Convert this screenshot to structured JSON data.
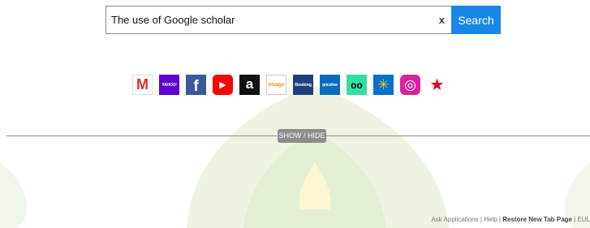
{
  "search": {
    "query": "The use of Google scholar",
    "clear_label": "x",
    "button_label": "Search"
  },
  "shortcuts": [
    {
      "name": "gmail",
      "label": "M",
      "color": "#ffffff"
    },
    {
      "name": "yahoo",
      "label": "YAHOO!",
      "color": "#5f01d1"
    },
    {
      "name": "facebook",
      "label": "f",
      "color": "#3b5998"
    },
    {
      "name": "youtube",
      "label": "▶",
      "color": "#ff0000"
    },
    {
      "name": "amazon",
      "label": "a",
      "color": "#111111"
    },
    {
      "name": "trivago",
      "label": "trivago",
      "color": "#ffffff"
    },
    {
      "name": "booking",
      "label": "Booking",
      "color": "#1e3f7a"
    },
    {
      "name": "priceline",
      "label": "priceline",
      "color": "#0a6bbd"
    },
    {
      "name": "tripadvisor",
      "label": "oo",
      "color": "#34e0a1"
    },
    {
      "name": "walmart",
      "label": "✳",
      "color": "#0071ce"
    },
    {
      "name": "instagram",
      "label": "◎",
      "color": "#d6249f"
    },
    {
      "name": "macys",
      "label": "★",
      "color": "#e2001a"
    }
  ],
  "toggle": {
    "label": "SHOW / HIDE"
  },
  "footer": {
    "ask_applications": "Ask Applications",
    "sep": "|",
    "help": "Help",
    "restore": "Restore New Tab Page",
    "eula": "EUL"
  },
  "colors": {
    "accent": "#1987e6",
    "background_shape": "#e8f2d8"
  }
}
